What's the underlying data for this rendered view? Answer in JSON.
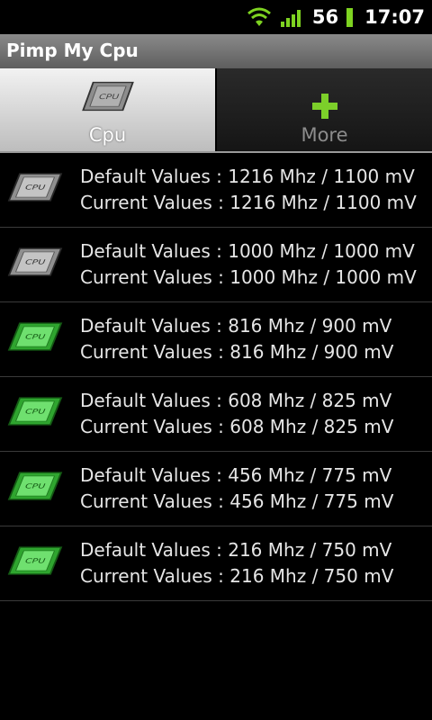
{
  "status": {
    "signal_number": "56",
    "time": "17:07"
  },
  "app": {
    "title": "Pimp My Cpu"
  },
  "tabs": [
    {
      "label": "Cpu",
      "selected": true,
      "icon": "cpu-chip-icon"
    },
    {
      "label": "More",
      "selected": false,
      "icon": "plus-icon"
    }
  ],
  "colors": {
    "chip_gray": "#9a9a9a",
    "chip_green": "#3cc43c",
    "plus_green": "#7ccf2a"
  },
  "rows": [
    {
      "default": "Default Values : 1216 Mhz / 1100 mV",
      "current": "Current Values : 1216 Mhz / 1100 mV",
      "icon": "cpu-chip-gray-icon"
    },
    {
      "default": "Default Values : 1000 Mhz / 1000 mV",
      "current": "Current Values : 1000 Mhz / 1000 mV",
      "icon": "cpu-chip-gray-icon"
    },
    {
      "default": "Default Values : 816 Mhz / 900 mV",
      "current": "Current Values : 816 Mhz / 900 mV",
      "icon": "cpu-chip-green-icon"
    },
    {
      "default": "Default Values : 608 Mhz / 825 mV",
      "current": "Current Values : 608 Mhz / 825 mV",
      "icon": "cpu-chip-green-icon"
    },
    {
      "default": "Default Values : 456 Mhz / 775 mV",
      "current": "Current Values : 456 Mhz / 775 mV",
      "icon": "cpu-chip-green-icon"
    },
    {
      "default": "Default Values : 216 Mhz / 750 mV",
      "current": "Current Values : 216 Mhz / 750 mV",
      "icon": "cpu-chip-green-icon"
    }
  ]
}
